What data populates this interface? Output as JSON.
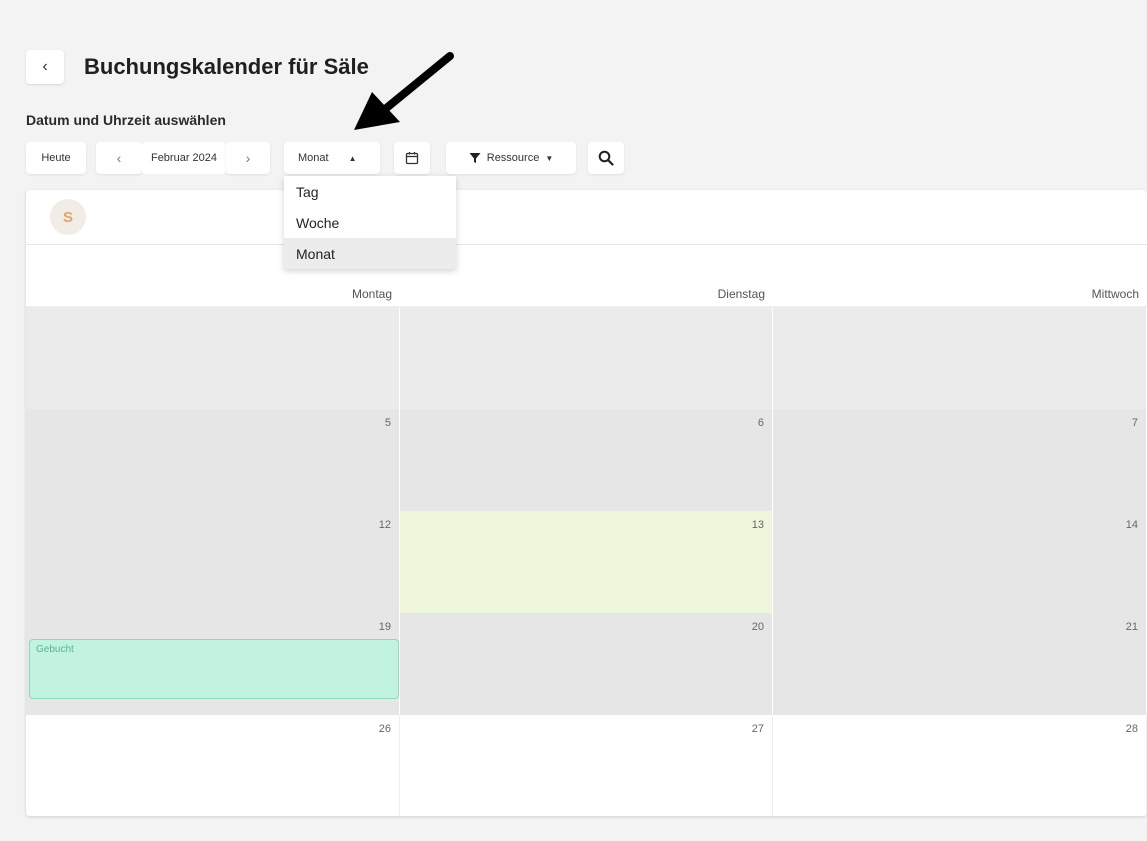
{
  "header": {
    "back_icon": "‹",
    "title": "Buchungskalender für Säle"
  },
  "subtitle": "Datum und Uhrzeit auswählen",
  "toolbar": {
    "today_label": "Heute",
    "prev_icon": "‹",
    "month_label": "Februar 2024",
    "next_icon": "›",
    "view_label": "Monat",
    "view_caret": "▲",
    "resource_label": "Ressource",
    "resource_caret": "▼"
  },
  "dropdown": {
    "items": [
      "Tag",
      "Woche",
      "Monat"
    ],
    "selected": "Monat"
  },
  "card": {
    "avatar_initial": "S"
  },
  "calendar": {
    "weekdays": [
      "Montag",
      "Dienstag",
      "Mittwoch"
    ],
    "rows": [
      [
        "",
        "",
        ""
      ],
      [
        "5",
        "6",
        "7"
      ],
      [
        "12",
        "13",
        "14"
      ],
      [
        "19",
        "20",
        "21"
      ],
      [
        "26",
        "27",
        "28"
      ]
    ],
    "event_label": "Gebucht"
  },
  "colors": {
    "today_bg": "#eef7dc",
    "event_bg": "#c2f2e0",
    "event_text": "#51b890"
  }
}
